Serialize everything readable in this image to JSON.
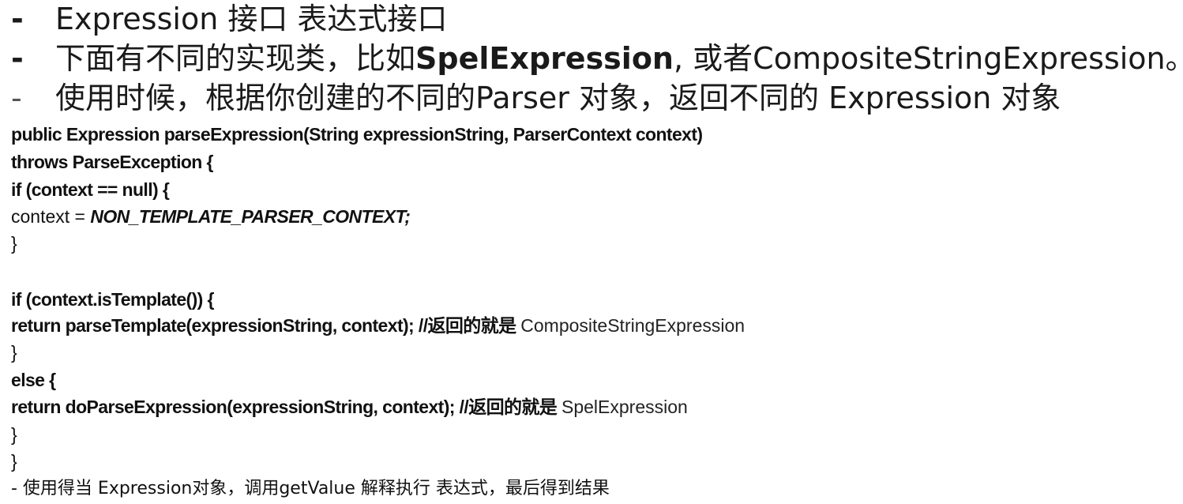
{
  "bullets": [
    {
      "dash": "-",
      "text": "Expression 接口 表达式接口"
    },
    {
      "dash": "-",
      "text_a": "下面有不同的实现类，比如",
      "text_b": "SpelExpression",
      "text_c": ", 或者CompositeStringExpression。"
    },
    {
      "dash": "-",
      "text": "使用时候，根据你创建的不同的Parser 对象，返回不同的  Expression 对象"
    }
  ],
  "code": {
    "l1": "public Expression parseExpression(String expressionString, ParserContext context)",
    "l2": "throws ParseException {",
    "l3": "if (context == null) {",
    "l4_a": "context = ",
    "l4_b": "NON_TEMPLATE_PARSER_CONTEXT;",
    "l5": "}",
    "l6": "if (context.isTemplate()) {",
    "l7_a": "return parseTemplate(expressionString, context); //返回的就是 ",
    "l7_b": "CompositeStringExpression",
    "l8": "}",
    "l9": "else {",
    "l10_a": "return doParseExpression(expressionString, context); //返回的就是 ",
    "l10_b": "SpelExpression",
    "l11": "}",
    "l12": "}"
  },
  "footer": "- 使用得当 Expression对象，调用getValue 解释执行 表达式，最后得到结果"
}
